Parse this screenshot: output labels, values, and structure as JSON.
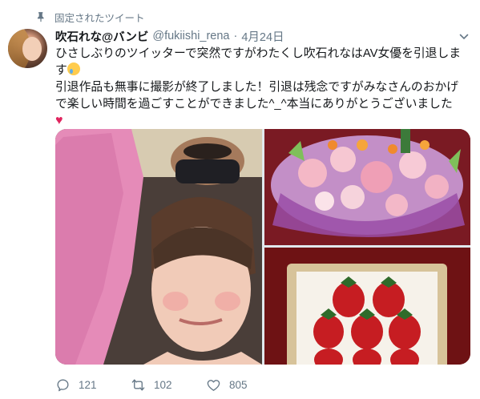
{
  "pinned": {
    "label": "固定されたツイート",
    "icon": "pin-icon"
  },
  "author": {
    "display_name": "吹石れな@バンビ",
    "handle": "@fukiishi_rena",
    "separator": "·",
    "date": "4月24日"
  },
  "tweet": {
    "lines": [
      "ひさしぶりのツイッターで突然ですがわたくし吹石れなはAV女優を引退しま",
      "す",
      "引退作品も無事に撮影が終了しました！引退は残念ですがみなさんのおかげ",
      "で楽しい時間を過ごすことができました^_^本当にありがとうございました"
    ],
    "emoji_after_line2": "crying-face-emoji",
    "emoji_end": "red-heart-emoji"
  },
  "media": {
    "photos": [
      {
        "name": "selfie-photo"
      },
      {
        "name": "flower-bouquet-photo"
      },
      {
        "name": "strawberries-photo"
      }
    ]
  },
  "actions": {
    "reply_count": "121",
    "retweet_count": "102",
    "like_count": "805"
  },
  "colors": {
    "text": "#14171a",
    "secondary": "#657786",
    "heart": "#e0245e"
  }
}
